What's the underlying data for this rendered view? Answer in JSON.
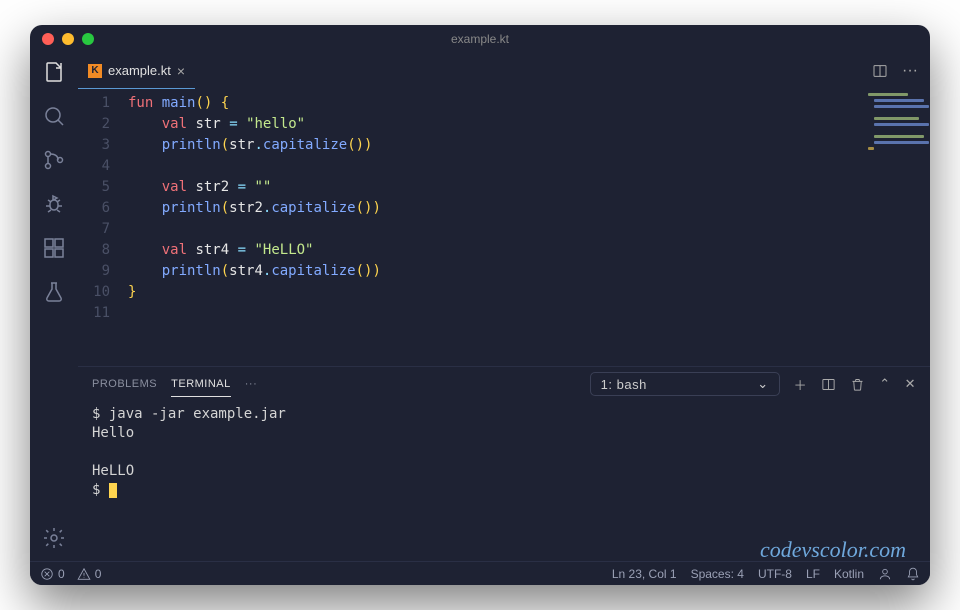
{
  "titlebar": {
    "title": "example.kt"
  },
  "tabs": {
    "file_icon_letter": "K",
    "filename": "example.kt"
  },
  "editor": {
    "lines": [
      {
        "n": "1",
        "i": 0,
        "t": [
          {
            "c": "tk-kw",
            "s": "fun"
          },
          {
            "c": "",
            "s": " "
          },
          {
            "c": "tk-fn",
            "s": "main"
          },
          {
            "c": "tk-br",
            "s": "()"
          },
          {
            "c": "",
            "s": " "
          },
          {
            "c": "tk-br",
            "s": "{"
          }
        ]
      },
      {
        "n": "2",
        "i": 1,
        "t": [
          {
            "c": "tk-kw",
            "s": "val"
          },
          {
            "c": "",
            "s": " "
          },
          {
            "c": "tk-id",
            "s": "str"
          },
          {
            "c": "",
            "s": " "
          },
          {
            "c": "tk-punc",
            "s": "="
          },
          {
            "c": "",
            "s": " "
          },
          {
            "c": "tk-str",
            "s": "\"hello\""
          }
        ]
      },
      {
        "n": "3",
        "i": 1,
        "t": [
          {
            "c": "tk-fn",
            "s": "println"
          },
          {
            "c": "tk-br",
            "s": "("
          },
          {
            "c": "tk-id",
            "s": "str"
          },
          {
            "c": "tk-dot",
            "s": "."
          },
          {
            "c": "tk-fn",
            "s": "capitalize"
          },
          {
            "c": "tk-br",
            "s": "())"
          }
        ]
      },
      {
        "n": "4",
        "i": 0,
        "t": []
      },
      {
        "n": "5",
        "i": 1,
        "t": [
          {
            "c": "tk-kw",
            "s": "val"
          },
          {
            "c": "",
            "s": " "
          },
          {
            "c": "tk-id",
            "s": "str2"
          },
          {
            "c": "",
            "s": " "
          },
          {
            "c": "tk-punc",
            "s": "="
          },
          {
            "c": "",
            "s": " "
          },
          {
            "c": "tk-str",
            "s": "\"\""
          }
        ]
      },
      {
        "n": "6",
        "i": 1,
        "t": [
          {
            "c": "tk-fn",
            "s": "println"
          },
          {
            "c": "tk-br",
            "s": "("
          },
          {
            "c": "tk-id",
            "s": "str2"
          },
          {
            "c": "tk-dot",
            "s": "."
          },
          {
            "c": "tk-fn",
            "s": "capitalize"
          },
          {
            "c": "tk-br",
            "s": "())"
          }
        ]
      },
      {
        "n": "7",
        "i": 0,
        "t": []
      },
      {
        "n": "8",
        "i": 1,
        "t": [
          {
            "c": "tk-kw",
            "s": "val"
          },
          {
            "c": "",
            "s": " "
          },
          {
            "c": "tk-id",
            "s": "str4"
          },
          {
            "c": "",
            "s": " "
          },
          {
            "c": "tk-punc",
            "s": "="
          },
          {
            "c": "",
            "s": " "
          },
          {
            "c": "tk-str",
            "s": "\"HeLLO\""
          }
        ]
      },
      {
        "n": "9",
        "i": 1,
        "t": [
          {
            "c": "tk-fn",
            "s": "println"
          },
          {
            "c": "tk-br",
            "s": "("
          },
          {
            "c": "tk-id",
            "s": "str4"
          },
          {
            "c": "tk-dot",
            "s": "."
          },
          {
            "c": "tk-fn",
            "s": "capitalize"
          },
          {
            "c": "tk-br",
            "s": "())"
          }
        ]
      },
      {
        "n": "10",
        "i": 0,
        "t": [
          {
            "c": "tk-br",
            "s": "}"
          }
        ]
      },
      {
        "n": "11",
        "i": 0,
        "t": []
      }
    ]
  },
  "panel": {
    "tabs": {
      "problems": "PROBLEMS",
      "terminal": "TERMINAL"
    },
    "terminal_select": "1: bash",
    "output": [
      "$ java -jar example.jar",
      "Hello",
      "",
      "HeLLO",
      "$ "
    ]
  },
  "statusbar": {
    "errors": "0",
    "warnings": "0",
    "position": "Ln 23, Col 1",
    "spaces": "Spaces: 4",
    "encoding": "UTF-8",
    "eol": "LF",
    "language": "Kotlin"
  },
  "watermark": "codevscolor.com"
}
